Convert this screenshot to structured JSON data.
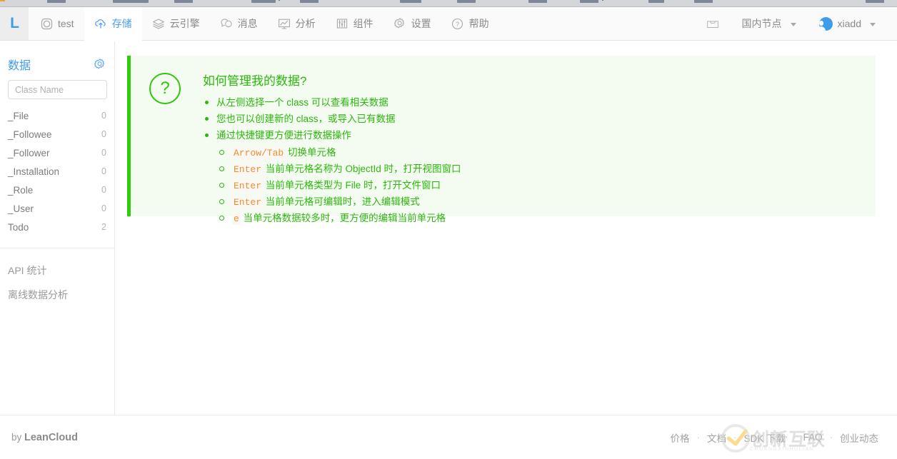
{
  "browser": {
    "chrome_visible": true
  },
  "topnav": {
    "logo": "L",
    "app_name": "test",
    "items": [
      {
        "label": "存储",
        "icon": "cloud-upload-icon",
        "active": true
      },
      {
        "label": "云引擎",
        "icon": "layers-icon",
        "active": false
      },
      {
        "label": "消息",
        "icon": "chat-bubbles-icon",
        "active": false
      },
      {
        "label": "分析",
        "icon": "chart-board-icon",
        "active": false
      },
      {
        "label": "组件",
        "icon": "sliders-icon",
        "active": false
      },
      {
        "label": "设置",
        "icon": "gear-icon",
        "active": false
      },
      {
        "label": "帮助",
        "icon": "question-circle-icon",
        "active": false
      }
    ],
    "inbox_icon": "inbox-icon",
    "region_label": "国内节点",
    "user_name": "xiadd",
    "accent_color": "#4a9df0"
  },
  "sidebar": {
    "title": "数据",
    "settings_icon": "gear-icon",
    "search": {
      "value": "",
      "placeholder": "Class Name"
    },
    "classes": [
      {
        "name": "_File",
        "count": "0"
      },
      {
        "name": "_Followee",
        "count": "0"
      },
      {
        "name": "_Follower",
        "count": "0"
      },
      {
        "name": "_Installation",
        "count": "0"
      },
      {
        "name": "_Role",
        "count": "0"
      },
      {
        "name": "_User",
        "count": "0"
      },
      {
        "name": "Todo",
        "count": "2"
      }
    ],
    "links": [
      {
        "label": "API 统计"
      },
      {
        "label": "离线数据分析"
      }
    ]
  },
  "help_panel": {
    "icon": "question-mark-icon",
    "title": "如何管理我的数据?",
    "accent_color": "#2dcd09",
    "background_color": "#f4fcf2",
    "bullets": [
      {
        "text": "从左侧选择一个 class 可以查看相关数据"
      },
      {
        "text": "您也可以创建新的 class，或导入已有数据"
      },
      {
        "text": "通过快捷键更方便进行数据操作",
        "sub": [
          {
            "code": "Arrow/Tab",
            "text": "切换单元格"
          },
          {
            "code": "Enter",
            "text": "当前单元格名称为 ObjectId 时，打开视图窗口"
          },
          {
            "code": "Enter",
            "text": "当前单元格类型为 File 时，打开文件窗口"
          },
          {
            "code": "Enter",
            "text": "当前单元格可编辑时，进入编辑模式"
          },
          {
            "code": "e",
            "text": "当单元格数据较多时，更方便的编辑当前单元格"
          }
        ]
      }
    ],
    "code_color": "#e8912d"
  },
  "footer": {
    "brand_prefix": "by ",
    "brand_name": "LeanCloud",
    "links": [
      {
        "label": "价格"
      },
      {
        "label": "文档"
      },
      {
        "label": "SDK 下载"
      },
      {
        "label": "FAQ"
      },
      {
        "label": "创业动态"
      }
    ],
    "separator": "·"
  },
  "watermark": {
    "text": "创新互联",
    "subtext": "CHUANGXINHULIAN"
  }
}
